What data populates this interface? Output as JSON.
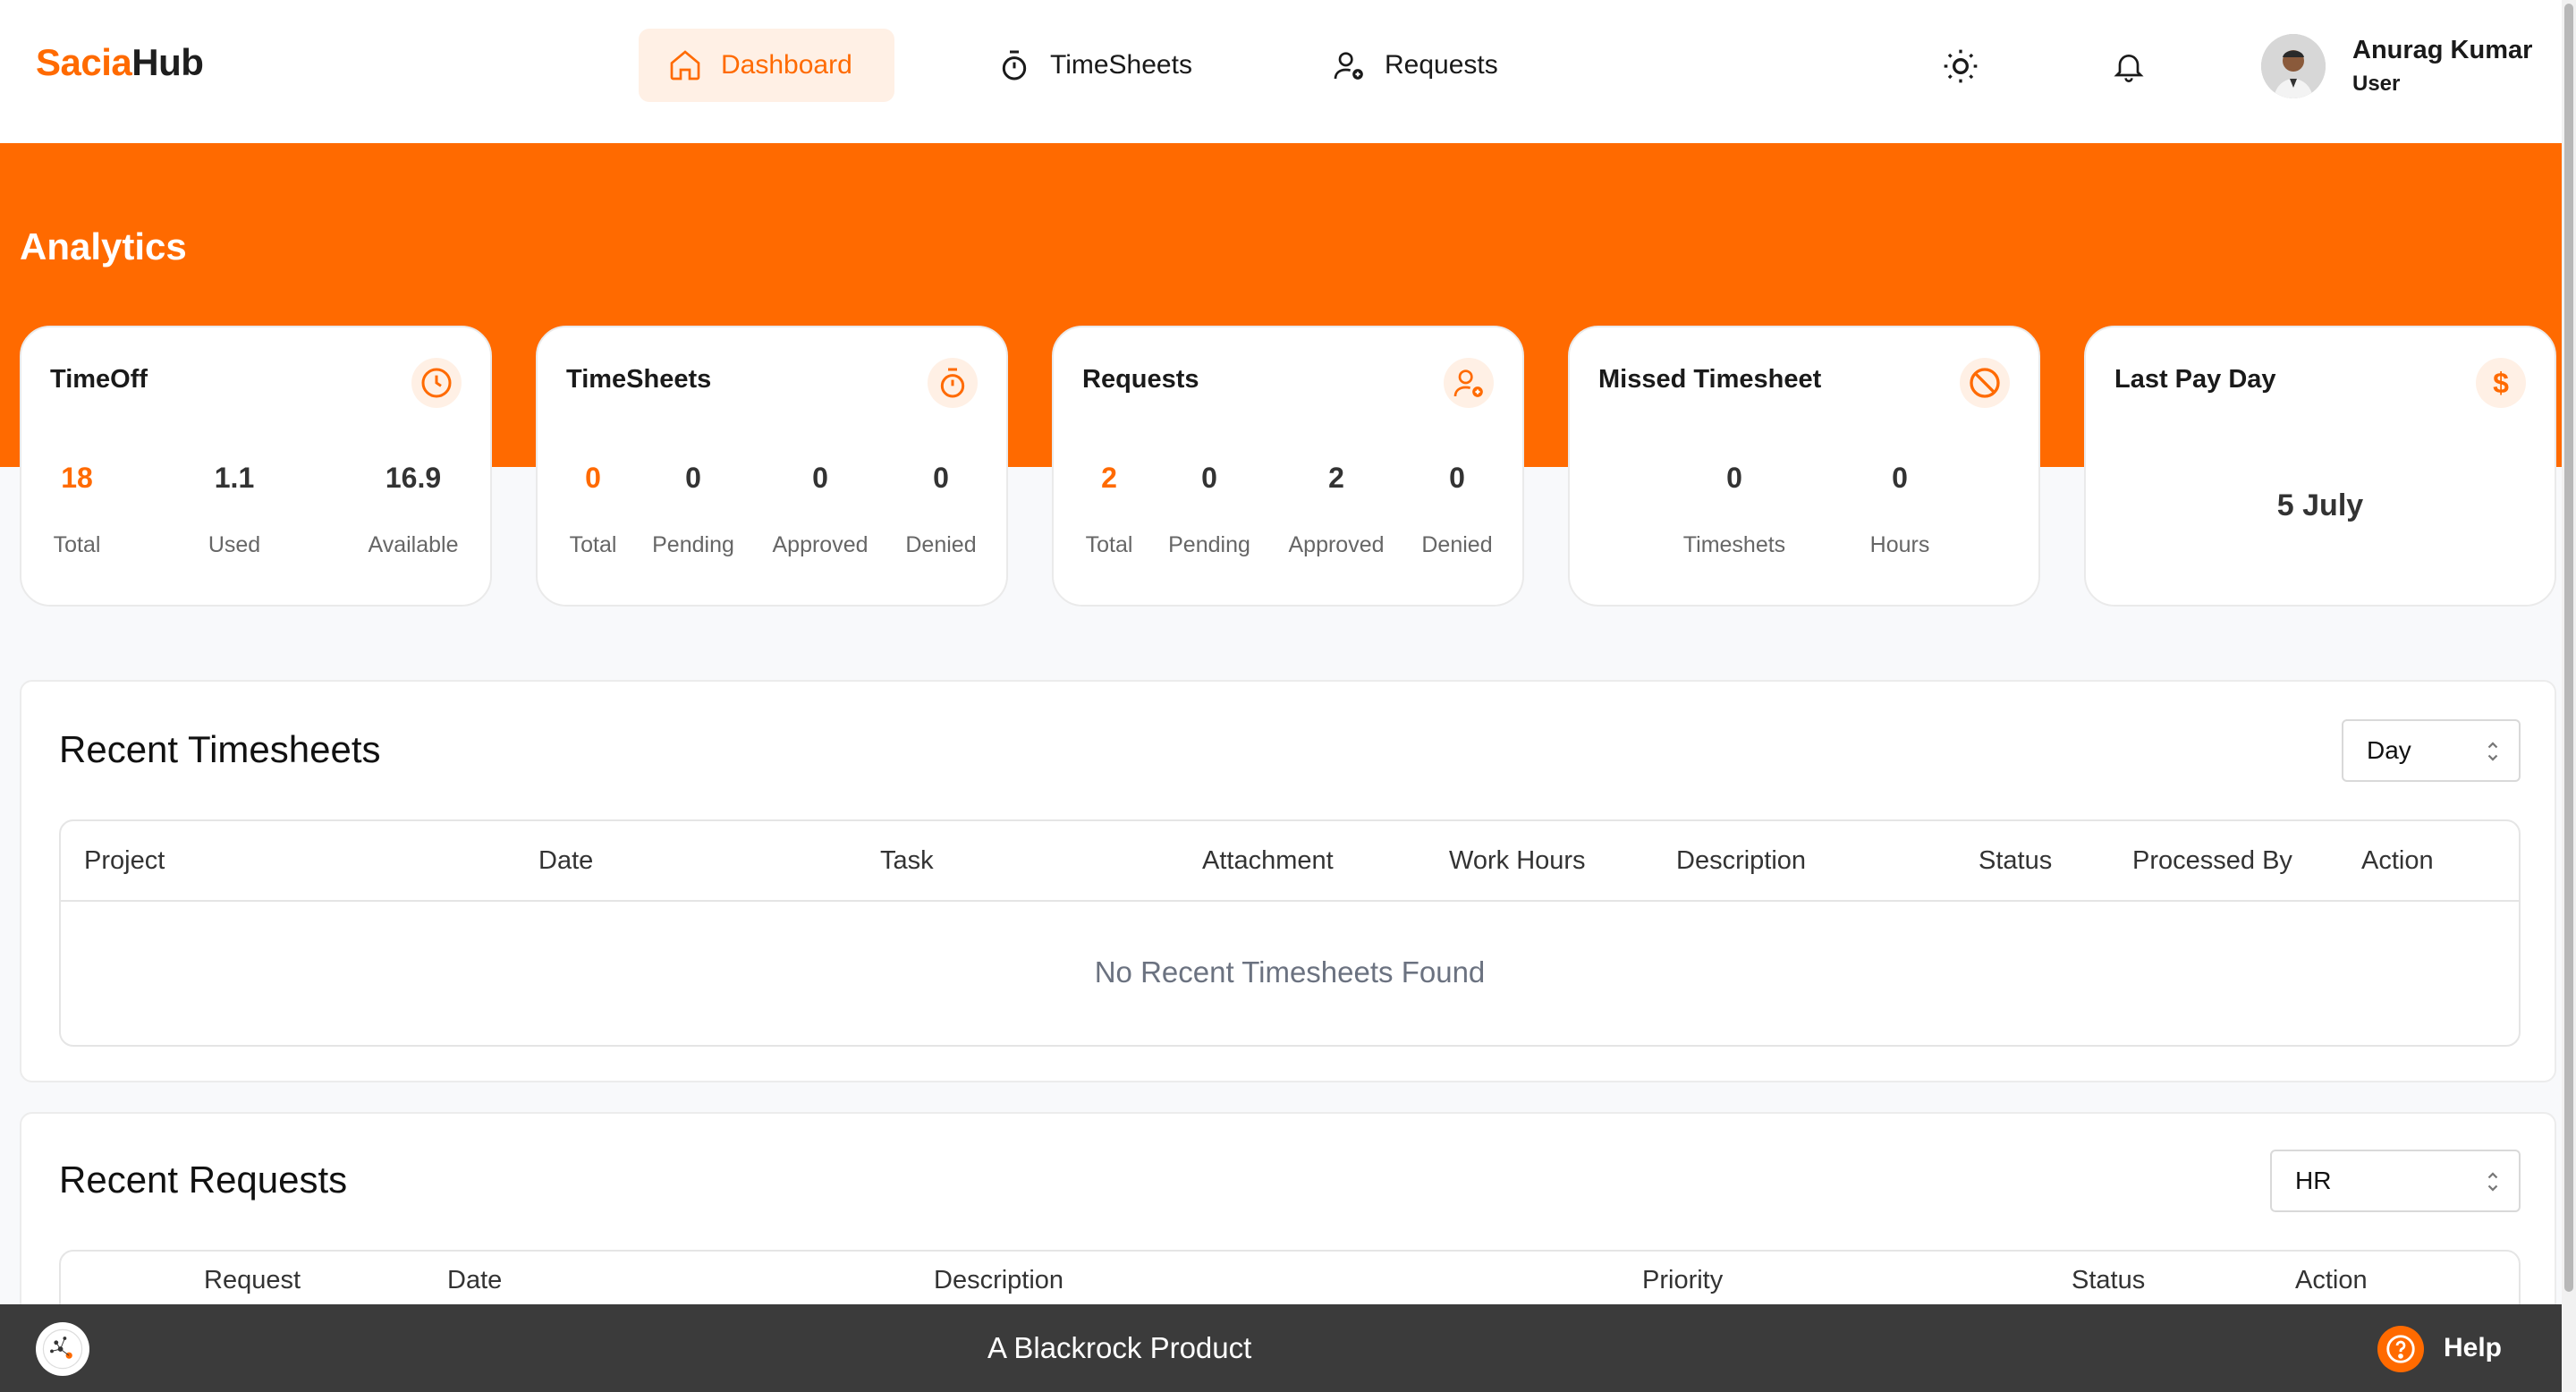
{
  "app": {
    "logo_part1": "Sacia",
    "logo_part2": "Hub"
  },
  "nav": {
    "dashboard": "Dashboard",
    "timesheets": "TimeSheets",
    "requests": "Requests"
  },
  "user": {
    "name": "Anurag Kumar",
    "role": "User"
  },
  "page": {
    "title": "Analytics"
  },
  "cards": {
    "timeoff": {
      "title": "TimeOff",
      "stats": [
        {
          "value": "18",
          "label": "Total"
        },
        {
          "value": "1.1",
          "label": "Used"
        },
        {
          "value": "16.9",
          "label": "Available"
        }
      ]
    },
    "timesheets": {
      "title": "TimeSheets",
      "stats": [
        {
          "value": "0",
          "label": "Total"
        },
        {
          "value": "0",
          "label": "Pending"
        },
        {
          "value": "0",
          "label": "Approved"
        },
        {
          "value": "0",
          "label": "Denied"
        }
      ]
    },
    "requests": {
      "title": "Requests",
      "stats": [
        {
          "value": "2",
          "label": "Total"
        },
        {
          "value": "0",
          "label": "Pending"
        },
        {
          "value": "2",
          "label": "Approved"
        },
        {
          "value": "0",
          "label": "Denied"
        }
      ]
    },
    "missed": {
      "title": "Missed Timesheet",
      "stats": [
        {
          "value": "0",
          "label": "Timeshets"
        },
        {
          "value": "0",
          "label": "Hours"
        }
      ]
    },
    "payday": {
      "title": "Last Pay Day",
      "icon_glyph": "$",
      "value": "5 July"
    }
  },
  "recent_timesheets": {
    "title": "Recent Timesheets",
    "filter": "Day",
    "columns": [
      "Project",
      "Date",
      "Task",
      "Attachment",
      "Work Hours",
      "Description",
      "Status",
      "Processed By",
      "Action"
    ],
    "empty_text": "No Recent Timesheets Found"
  },
  "recent_requests": {
    "title": "Recent Requests",
    "filter": "HR",
    "columns": [
      "Request",
      "Date",
      "Description",
      "Priority",
      "Status",
      "Action"
    ]
  },
  "footer": {
    "text": "A Blackrock Product",
    "help": "Help"
  },
  "colors": {
    "accent": "#ff6a00",
    "accent_light": "#fff0e5",
    "footer_bg": "#3b3b3b"
  }
}
